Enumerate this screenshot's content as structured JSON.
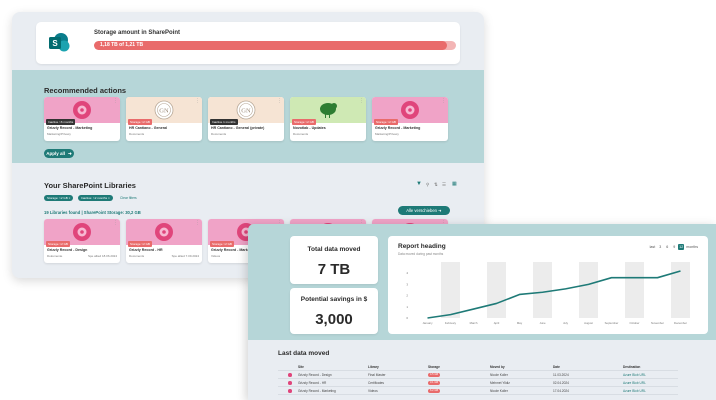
{
  "storage": {
    "title": "Storage amount in SharePoint",
    "value_text": "1,18 TB of 1,21 TB",
    "used_fraction": 0.975,
    "logo_letter": "S"
  },
  "recommended": {
    "title": "Recommended actions",
    "apply_label": "Apply all",
    "cards": [
      {
        "badge": "Inactive >6 months",
        "badge_color": "#333333",
        "title": "Grizzly Record - Marketing",
        "sub": "Marketing/Privacy",
        "sub2": "",
        "img": "pink-donut"
      },
      {
        "badge": "Storage >2 GB",
        "badge_color": "#e96b6b",
        "title": "HR Cantiano - General",
        "sub": "Documents",
        "sub2": "",
        "img": "beige-logo"
      },
      {
        "badge": "Inactive 1 months",
        "badge_color": "#333333",
        "title": "HR Cantiano - General (private)",
        "sub": "Documents",
        "sub2": "",
        "img": "beige-logo"
      },
      {
        "badge": "Storage >2 GB",
        "badge_color": "#e96b6b",
        "title": "Novotlab - Updates",
        "sub": "Documents",
        "sub2": "",
        "img": "green-kiwi"
      },
      {
        "badge": "Storage >2 GB",
        "badge_color": "#e96b6b",
        "title": "Grizzly Record - Marketing",
        "sub": "Marketing/Privacy",
        "sub2": "",
        "img": "pink-donut"
      }
    ]
  },
  "libraries": {
    "title": "Your SharePoint Libraries",
    "chips": [
      "Storage: >2 GB",
      "Inactive: >2 months"
    ],
    "clear_label": "Clear filters",
    "count_text": "19 Libraries found | SharePoint Storage: 30,2 GB",
    "all_button": "Alle verschieben",
    "cards": [
      {
        "badge": "Storage >2 GB",
        "badge_color": "#e96b6b",
        "title": "Grizzly Record - Design",
        "sub": "Dokumente",
        "sub2": "Spe allied 18.06.2024",
        "img": "pink-donut"
      },
      {
        "badge": "Storage >2 GB",
        "badge_color": "#e96b6b",
        "title": "Grizzly Record - HR",
        "sub": "Documents",
        "sub2": "Spe allied 7.09.2024",
        "img": "pink-donut"
      },
      {
        "badge": "Storage >2 GB",
        "badge_color": "#e96b6b",
        "title": "Grizzly Record - Mark",
        "sub": "Videos",
        "sub2": "",
        "img": "pink-donut"
      },
      {
        "badge": "",
        "badge_color": "#e96b6b",
        "title": "",
        "sub": "",
        "sub2": "",
        "img": "pink-donut"
      },
      {
        "badge": "",
        "badge_color": "#e96b6b",
        "title": "",
        "sub": "",
        "sub2": "",
        "img": "pink-donut"
      }
    ]
  },
  "stats": {
    "total_label": "Total data moved",
    "total_value": "7 TB",
    "savings_label": "Potential savings in $",
    "savings_value": "3,000"
  },
  "report": {
    "title": "Report heading",
    "subtitle": "Data moved during past months",
    "ctrl_label": "last",
    "ctrl_options": [
      "3",
      "6",
      "9",
      "12"
    ],
    "ctrl_selected": "12",
    "ctrl_unit": "months"
  },
  "chart_data": {
    "type": "line",
    "categories": [
      "January",
      "February",
      "March",
      "April",
      "May",
      "June",
      "July",
      "August",
      "September",
      "October",
      "November",
      "December"
    ],
    "series": [
      {
        "values": [
          0,
          0.3,
          0.8,
          1.3,
          2.1,
          2.3,
          2.6,
          3.0,
          3.6,
          3.6,
          3.6,
          4.2
        ]
      }
    ],
    "bar_highlight": [
      1,
      3,
      5,
      7,
      9,
      11
    ],
    "ylim": [
      0,
      5
    ],
    "yticks": [
      "0",
      "1",
      "2",
      "3",
      "4"
    ],
    "line_color": "#1e7a77",
    "bar_color": "#ececec"
  },
  "last_moved": {
    "title": "Last data moved",
    "columns": [
      "Site",
      "Library",
      "Storage",
      "Moved by",
      "Date",
      "Destination"
    ],
    "rows": [
      {
        "site": "Grizzly Record - Design",
        "library": "Final Master",
        "storage": "4.5 GB",
        "moved_by": "Nicole Koller",
        "date": "11.03.2024",
        "dest": "Azure Blob URL"
      },
      {
        "site": "Grizzly Record - HR",
        "library": "Certificates",
        "storage": "3.1 GB",
        "moved_by": "Mehmet Yildiz",
        "date": "02.04.2024",
        "dest": "Azure Blob URL"
      },
      {
        "site": "Grizzly Record - Marketing",
        "library": "Videos",
        "storage": "6.2 GB",
        "moved_by": "Nicole Koller",
        "date": "17.04.2024",
        "dest": "Azure Blob URL"
      }
    ]
  }
}
